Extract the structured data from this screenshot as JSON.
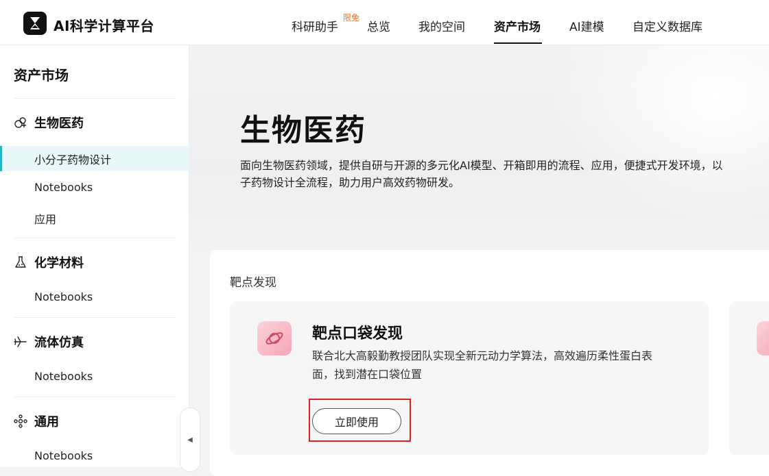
{
  "header": {
    "brand": "AI科学计算平台",
    "nav": [
      {
        "label": "科研助手"
      },
      {
        "label": "总览"
      },
      {
        "label": "我的空间"
      },
      {
        "label": "资产市场"
      },
      {
        "label": "AI建模"
      },
      {
        "label": "自定义数据库"
      }
    ],
    "badge": "限免",
    "active_nav": "资产市场"
  },
  "sidebar": {
    "title": "资产市场",
    "categories": [
      {
        "label": "生物医药",
        "icon": "bio-cells-icon",
        "items": [
          "小分子药物设计",
          "Notebooks",
          "应用"
        ]
      },
      {
        "label": "化学材料",
        "icon": "flask-icon",
        "items": [
          "Notebooks"
        ]
      },
      {
        "label": "流体仿真",
        "icon": "airplane-icon",
        "items": [
          "Notebooks"
        ]
      },
      {
        "label": "通用",
        "icon": "molecule-icon",
        "items": [
          "Notebooks"
        ]
      }
    ],
    "active_item": "小分子药物设计",
    "collapse_icon": "caret-left-icon"
  },
  "hero": {
    "title": "生物医药",
    "desc_line1": "面向生物医药领域，提供自研与开源的多元化AI模型、开箱即用的流程、应用，便捷式开发环境，以",
    "desc_line2": "子药物设计全流程，助力用户高效药物研发。"
  },
  "section": {
    "title": "靶点发现",
    "card": {
      "title": "靶点口袋发现",
      "desc": "联合北大高毅勤教授团队实现全新元动力学算法，高效遍历柔性蛋白表面，找到潜在口袋位置",
      "button": "立即使用",
      "icon": "planet-icon"
    }
  },
  "colors": {
    "accent": "#21b7c6",
    "active_bg": "#e8f8f8",
    "badge": "#ff6a1a",
    "highlight": "#e02020"
  }
}
